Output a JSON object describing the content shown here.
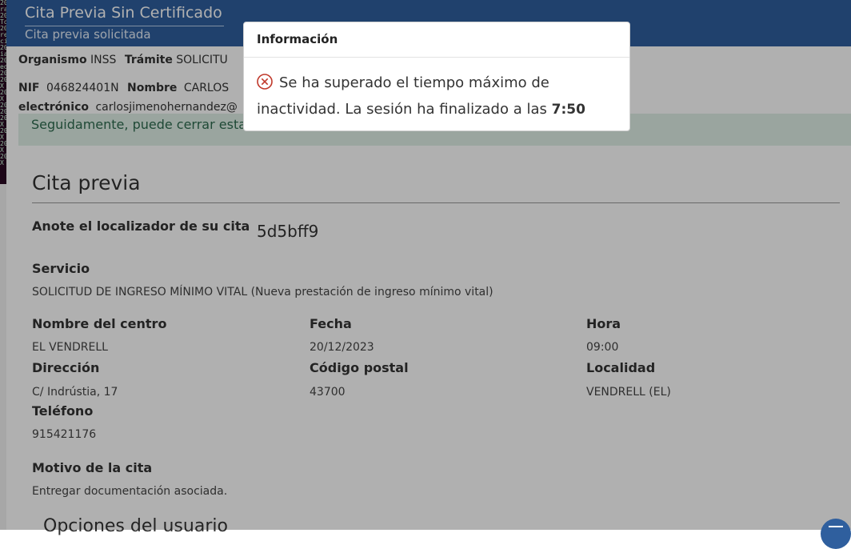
{
  "header": {
    "title": "Cita Previa Sin Certificado",
    "subtitle": "Cita previa solicitada"
  },
  "meta": {
    "organismo_label": "Organismo",
    "organismo_value": "INSS",
    "tramite_label": "Trámite",
    "tramite_value": "SOLICITU",
    "nif_label": "NIF",
    "nif_value": "046824401N",
    "nombre_label": "Nombre",
    "nombre_value": "CARLOS",
    "email_label": "electrónico",
    "email_value": "carlosjimenohernandez@"
  },
  "alert": {
    "text": "Seguidamente, puede cerrar esta"
  },
  "section": {
    "title": "Cita previa",
    "localizador_label": "Anote el localizador de su cita",
    "localizador_value": "5d5bff9",
    "servicio_label": "Servicio",
    "servicio_value": "SOLICITUD DE INGRESO MÍNIMO VITAL (Nueva prestación de ingreso mínimo vital)",
    "centro_label": "Nombre del centro",
    "centro_value": "EL VENDRELL",
    "fecha_label": "Fecha",
    "fecha_value": "20/12/2023",
    "hora_label": "Hora",
    "hora_value": "09:00",
    "direccion_label": "Dirección",
    "direccion_value": "C/ Indrústia, 17",
    "cp_label": "Código postal",
    "cp_value": "43700",
    "localidad_label": "Localidad",
    "localidad_value": "VENDRELL (EL)",
    "telefono_label": "Teléfono",
    "telefono_value": "915421176",
    "motivo_label": "Motivo de la cita",
    "motivo_value": "Entregar documentación asociada.",
    "opciones_title": "Opciones del usuario"
  },
  "dialog": {
    "title": "Información",
    "icon": "error-circle-icon",
    "message": "Se ha superado el tiempo máximo de inactividad. La sesión ha finalizado a las",
    "time": "7:50"
  },
  "colors": {
    "header_bg": "#2f5f9e",
    "alert_bg": "#dff0e6",
    "error_red": "#c0392b"
  }
}
